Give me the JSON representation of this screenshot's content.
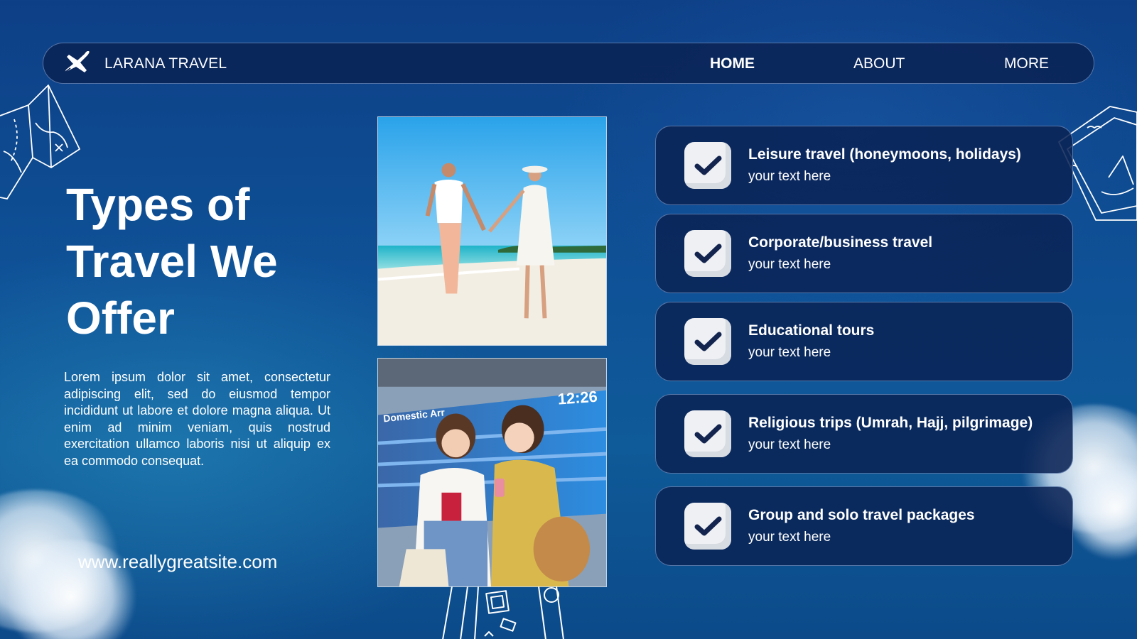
{
  "nav": {
    "brand": "LARANA TRAVEL",
    "links": [
      "HOME",
      "ABOUT",
      "MORE"
    ]
  },
  "headline": "Types of Travel We Offer",
  "body": "Lorem ipsum dolor sit amet, consectetur adipiscing elit, sed do eiusmod tempor incididunt ut labore et dolore magna aliqua. Ut enim ad minim veniam, quis nostrud exercitation ullamco laboris nisi ut aliquip ex ea commodo consequat.",
  "website": "www.reallygreatsite.com",
  "photo_signage": {
    "board_label": "Domestic Arr",
    "clock": "12:26"
  },
  "services": [
    {
      "title": "Leisure travel (honeymoons, holidays)",
      "subtitle": "your text here"
    },
    {
      "title": "Corporate/business travel",
      "subtitle": "your text here"
    },
    {
      "title": "Educational tours",
      "subtitle": "your text here"
    },
    {
      "title": "Religious trips (Umrah, Hajj, pilgrimage)",
      "subtitle": "your text here"
    },
    {
      "title": "Group and solo travel packages",
      "subtitle": "your text here"
    }
  ],
  "icons": {
    "brand": "airplane-icon",
    "check": "checkmark-icon",
    "decorations": [
      "map-icon",
      "postcard-icon",
      "luggage-icon"
    ]
  },
  "colors": {
    "background": "#0f5297",
    "panel": "#0a2355",
    "checkbox": "#eef0f3",
    "check": "#13244f",
    "text": "#ffffff"
  }
}
